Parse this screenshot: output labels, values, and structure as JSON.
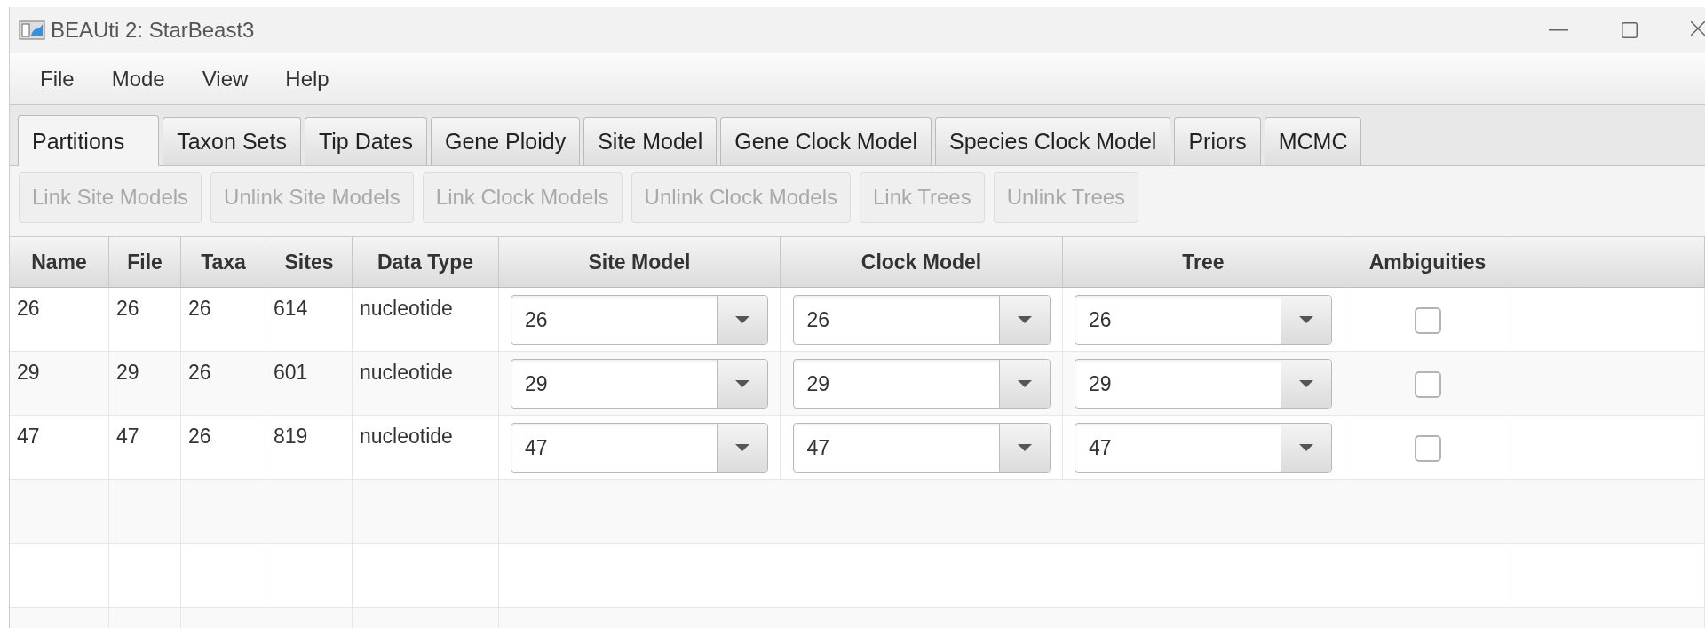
{
  "window": {
    "title": "BEAUti 2: StarBeast3"
  },
  "menu": [
    "File",
    "Mode",
    "View",
    "Help"
  ],
  "tabs": [
    {
      "label": "Partitions",
      "selected": true
    },
    {
      "label": "Taxon Sets",
      "selected": false
    },
    {
      "label": "Tip Dates",
      "selected": false
    },
    {
      "label": "Gene Ploidy",
      "selected": false
    },
    {
      "label": "Site Model",
      "selected": false
    },
    {
      "label": "Gene Clock Model",
      "selected": false
    },
    {
      "label": "Species Clock Model",
      "selected": false
    },
    {
      "label": "Priors",
      "selected": false
    },
    {
      "label": "MCMC",
      "selected": false
    }
  ],
  "toolbar": [
    {
      "label": "Link Site Models",
      "disabled": true
    },
    {
      "label": "Unlink Site Models",
      "disabled": true
    },
    {
      "label": "Link Clock Models",
      "disabled": true
    },
    {
      "label": "Unlink Clock Models",
      "disabled": true
    },
    {
      "label": "Link Trees",
      "disabled": true
    },
    {
      "label": "Unlink Trees",
      "disabled": true
    }
  ],
  "table": {
    "columns": [
      "Name",
      "File",
      "Taxa",
      "Sites",
      "Data Type",
      "Site Model",
      "Clock Model",
      "Tree",
      "Ambiguities"
    ],
    "rows": [
      {
        "name": "26",
        "file": "26",
        "taxa": "26",
        "sites": "614",
        "data_type": "nucleotide",
        "site_model": "26",
        "clock_model": "26",
        "tree": "26",
        "ambiguities": false
      },
      {
        "name": "29",
        "file": "29",
        "taxa": "26",
        "sites": "601",
        "data_type": "nucleotide",
        "site_model": "29",
        "clock_model": "29",
        "tree": "29",
        "ambiguities": false
      },
      {
        "name": "47",
        "file": "47",
        "taxa": "26",
        "sites": "819",
        "data_type": "nucleotide",
        "site_model": "47",
        "clock_model": "47",
        "tree": "47",
        "ambiguities": false
      }
    ]
  }
}
